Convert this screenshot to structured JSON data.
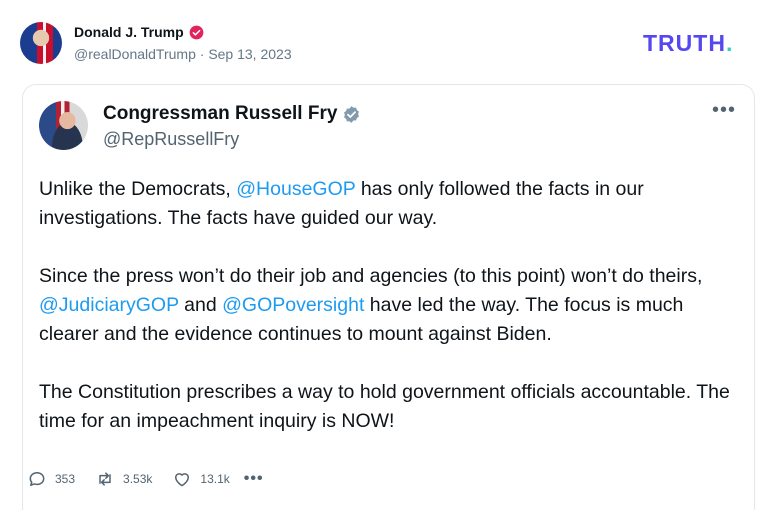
{
  "post": {
    "author_name": "Donald J. Trump",
    "handle": "@realDonaldTrump",
    "date": "Sep 13, 2023",
    "separator": "·"
  },
  "brand": {
    "logo_main": "TRUTH",
    "logo_dot": "."
  },
  "embedded": {
    "name": "Congressman Russell Fry",
    "handle": "@RepRussellFry",
    "more_label": "•••",
    "p1_a": "Unlike the Democrats, ",
    "p1_mention": "@HouseGOP",
    "p1_b": " has only followed the facts in our investigations. The facts have guided our way.",
    "p2_a": "Since the press won’t do their job and agencies (to this point) won’t do theirs, ",
    "p2_mention1": "@JudiciaryGOP",
    "p2_and": " and ",
    "p2_mention2": "@GOPoversight",
    "p2_b": " have led the way. The focus is much clearer and the evidence continues to mount against Biden.",
    "p3": "The Constitution prescribes a way to hold government officials accountable. The time for an impeachment inquiry is NOW!",
    "replies": "353",
    "retweets": "3.53k",
    "likes": "13.1k",
    "more_actions": "•••"
  },
  "colors": {
    "mention": "#1d9bf0",
    "truth_logo": "#5448ee",
    "truth_dot": "#2ed3b7",
    "verified_red": "#e0245e"
  },
  "icons": [
    "verified-badge-icon",
    "reply-icon",
    "retweet-icon",
    "like-icon",
    "more-icon"
  ]
}
